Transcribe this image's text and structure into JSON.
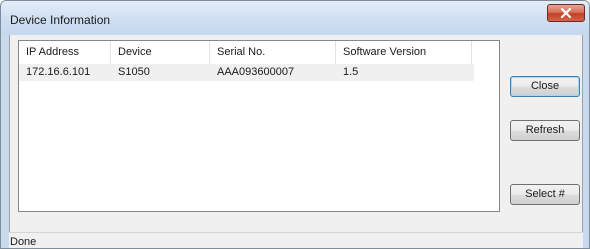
{
  "window": {
    "title": "Device Information",
    "close_glyph": "x"
  },
  "list": {
    "columns": [
      "IP Address",
      "Device",
      "Serial No.",
      "Software Version"
    ],
    "rows": [
      [
        "172.16.6.101",
        "S1050",
        "AAA093600007",
        "1.5"
      ]
    ]
  },
  "buttons": {
    "close": "Close",
    "refresh": "Refresh",
    "select": "Select #"
  },
  "status": {
    "text": "Done"
  },
  "colors": {
    "titlebar": "#cfdff1",
    "close_button": "#c33f25",
    "selected_row": "#f0f0f0"
  }
}
